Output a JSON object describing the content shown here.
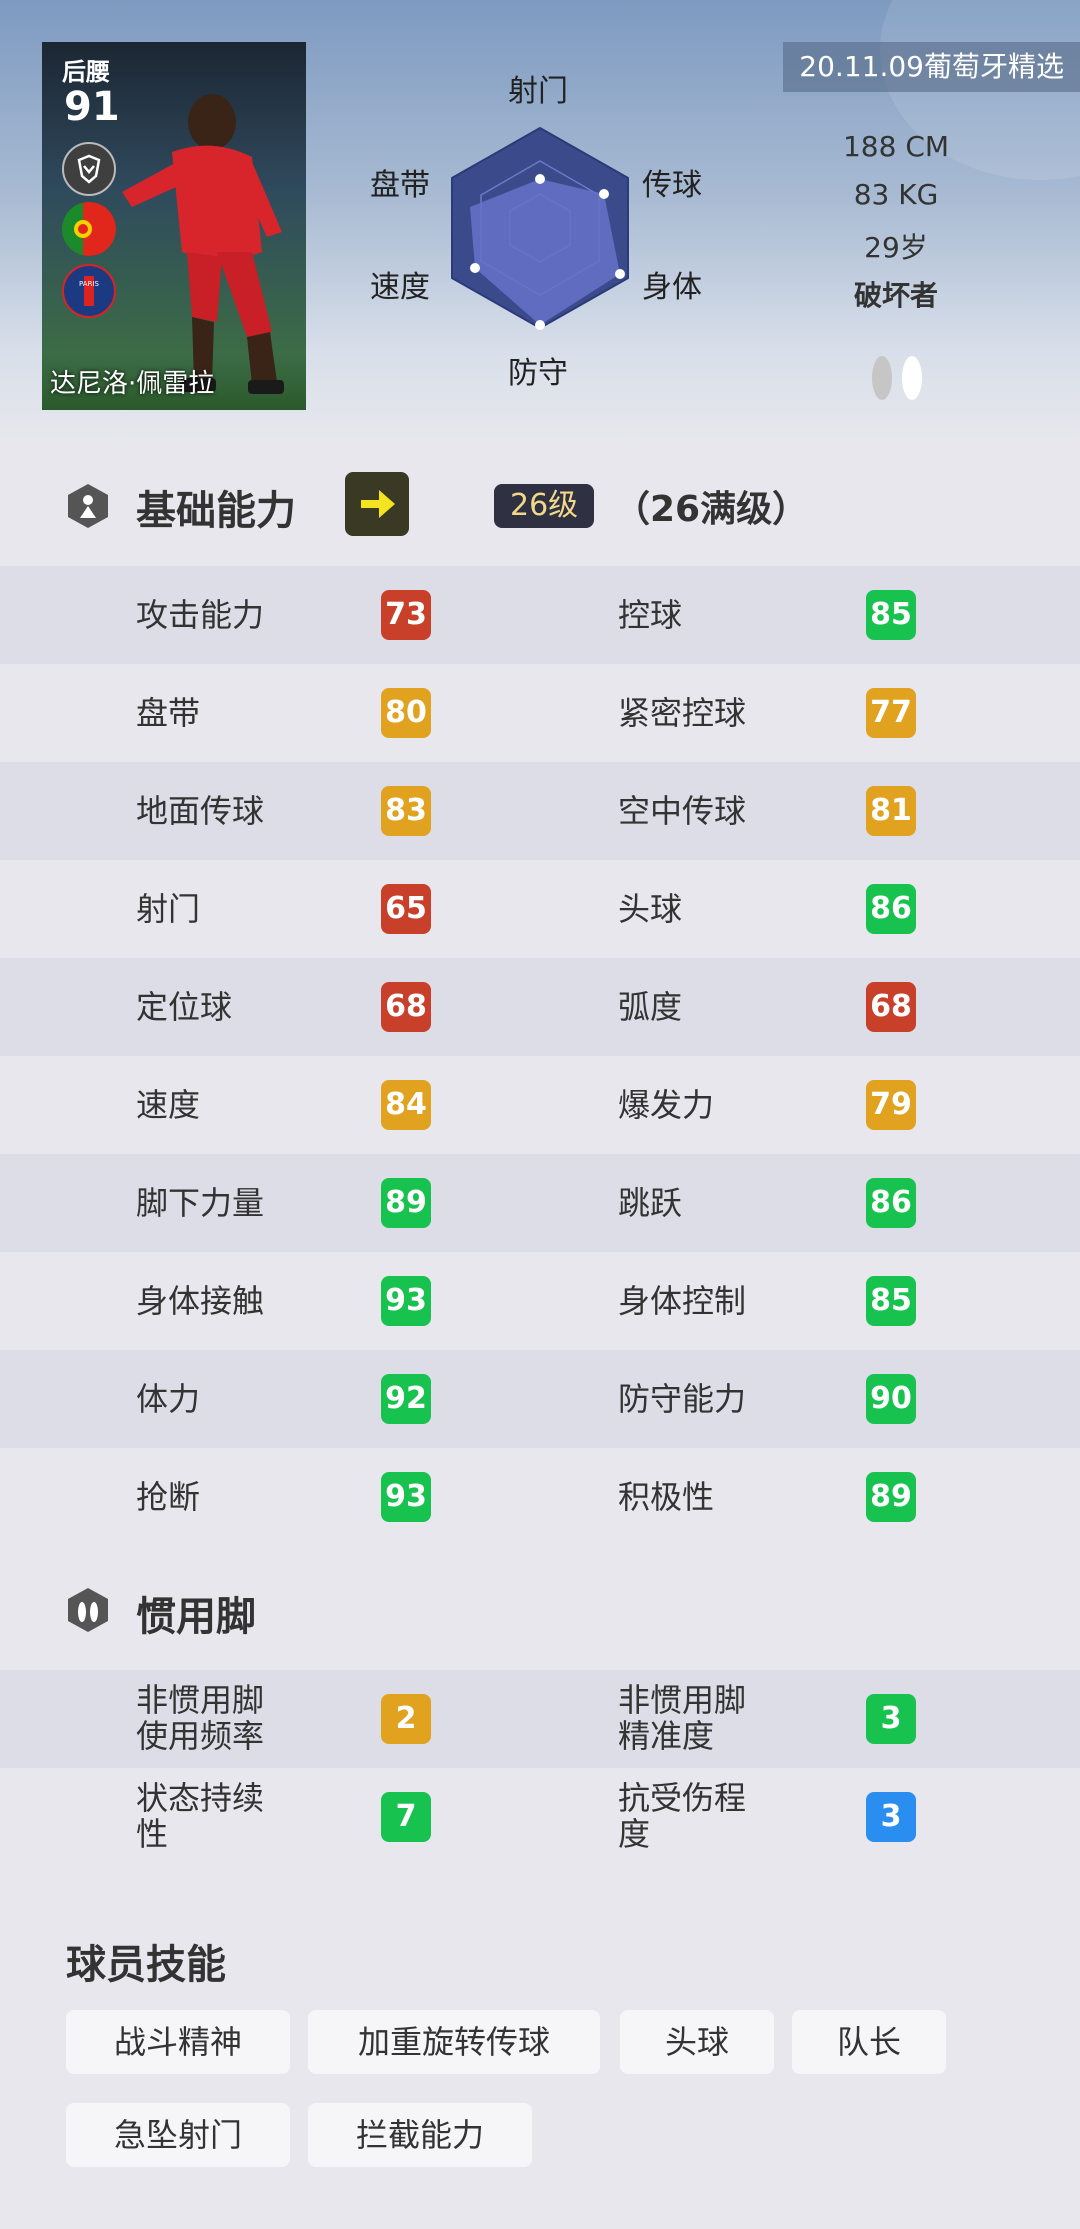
{
  "card": {
    "position": "后腰",
    "rating": "91",
    "name": "达尼洛·佩雷拉"
  },
  "radar": {
    "labels": {
      "shooting": "射门",
      "passing": "传球",
      "physical": "身体",
      "defending": "防守",
      "speed": "速度",
      "dribbling": "盘带"
    }
  },
  "info": {
    "edition": "20.11.09葡萄牙精选",
    "height": "188 CM",
    "weight": "83 KG",
    "age": "29岁",
    "playstyle": "破坏者"
  },
  "basic": {
    "title": "基础能力",
    "level": "26级",
    "level_max": "（26满级）"
  },
  "colors": {
    "red": "#c9402a",
    "orange": "#e0a21f",
    "green": "#18c24e",
    "blue": "#2a8ef0"
  },
  "stats": [
    {
      "left_name": "攻击能力",
      "left_val": "73",
      "left_color": "red",
      "right_name": "控球",
      "right_val": "85",
      "right_color": "green"
    },
    {
      "left_name": "盘带",
      "left_val": "80",
      "left_color": "orange",
      "right_name": "紧密控球",
      "right_val": "77",
      "right_color": "orange"
    },
    {
      "left_name": "地面传球",
      "left_val": "83",
      "left_color": "orange",
      "right_name": "空中传球",
      "right_val": "81",
      "right_color": "orange"
    },
    {
      "left_name": "射门",
      "left_val": "65",
      "left_color": "red",
      "right_name": "头球",
      "right_val": "86",
      "right_color": "green"
    },
    {
      "left_name": "定位球",
      "left_val": "68",
      "left_color": "red",
      "right_name": "弧度",
      "right_val": "68",
      "right_color": "red"
    },
    {
      "left_name": "速度",
      "left_val": "84",
      "left_color": "orange",
      "right_name": "爆发力",
      "right_val": "79",
      "right_color": "orange"
    },
    {
      "left_name": "脚下力量",
      "left_val": "89",
      "left_color": "green",
      "right_name": "跳跃",
      "right_val": "86",
      "right_color": "green"
    },
    {
      "left_name": "身体接触",
      "left_val": "93",
      "left_color": "green",
      "right_name": "身体控制",
      "right_val": "85",
      "right_color": "green"
    },
    {
      "left_name": "体力",
      "left_val": "92",
      "left_color": "green",
      "right_name": "防守能力",
      "right_val": "90",
      "right_color": "green"
    },
    {
      "left_name": "抢断",
      "left_val": "93",
      "left_color": "green",
      "right_name": "积极性",
      "right_val": "89",
      "right_color": "green"
    }
  ],
  "foot": {
    "title": "惯用脚",
    "rows": [
      {
        "left_name": [
          "非惯用脚",
          "使用频率"
        ],
        "left_val": "2",
        "left_color": "orange",
        "right_name": [
          "非惯用脚",
          "精准度"
        ],
        "right_val": "3",
        "right_color": "green"
      },
      {
        "left_name": [
          "状态持续",
          "性"
        ],
        "left_val": "7",
        "left_color": "green",
        "right_name": [
          "抗受伤程",
          "度"
        ],
        "right_val": "3",
        "right_color": "blue"
      }
    ]
  },
  "skills": {
    "title": "球员技能",
    "items": [
      "战斗精神",
      "加重旋转传球",
      "头球",
      "队长",
      "急坠射门",
      "拦截能力"
    ]
  }
}
